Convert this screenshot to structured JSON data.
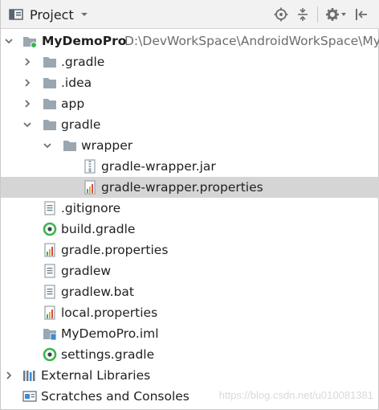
{
  "header": {
    "title": "Project",
    "icons": [
      "project-panel-icon",
      "dropdown-caret-icon",
      "locate-icon",
      "collapse-all-icon",
      "gear-icon",
      "hide-panel-icon"
    ]
  },
  "tree": {
    "root": {
      "label": "MyDemoPro",
      "path": "D:\\DevWorkSpace\\AndroidWorkSpace\\My"
    },
    "items": [
      {
        "label": ".gradle",
        "icon": "folder-icon"
      },
      {
        "label": ".idea",
        "icon": "folder-icon"
      },
      {
        "label": "app",
        "icon": "folder-icon"
      },
      {
        "label": "gradle",
        "icon": "folder-icon"
      },
      {
        "label": "wrapper",
        "icon": "folder-icon"
      },
      {
        "label": "gradle-wrapper.jar",
        "icon": "jar-file-icon"
      },
      {
        "label": "gradle-wrapper.properties",
        "icon": "properties-file-icon"
      },
      {
        "label": ".gitignore",
        "icon": "text-file-icon"
      },
      {
        "label": "build.gradle",
        "icon": "gradle-file-icon"
      },
      {
        "label": "gradle.properties",
        "icon": "properties-file-icon"
      },
      {
        "label": "gradlew",
        "icon": "text-file-icon"
      },
      {
        "label": "gradlew.bat",
        "icon": "text-file-icon"
      },
      {
        "label": "local.properties",
        "icon": "properties-file-icon"
      },
      {
        "label": "MyDemoPro.iml",
        "icon": "module-file-icon"
      },
      {
        "label": "settings.gradle",
        "icon": "gradle-file-icon"
      },
      {
        "label": "External Libraries",
        "icon": "libraries-icon"
      },
      {
        "label": "Scratches and Consoles",
        "icon": "scratches-icon"
      }
    ],
    "selected_item": "gradle-wrapper.properties"
  },
  "watermark": "https://blog.csdn.net/u010081381",
  "colors": {
    "header_bg": "#f2f2f2",
    "selection_bg": "#d5d5d5",
    "folder": "#9aa7b0",
    "gradle_green": "#3ab54a",
    "module_blue": "#3d8ad8"
  }
}
